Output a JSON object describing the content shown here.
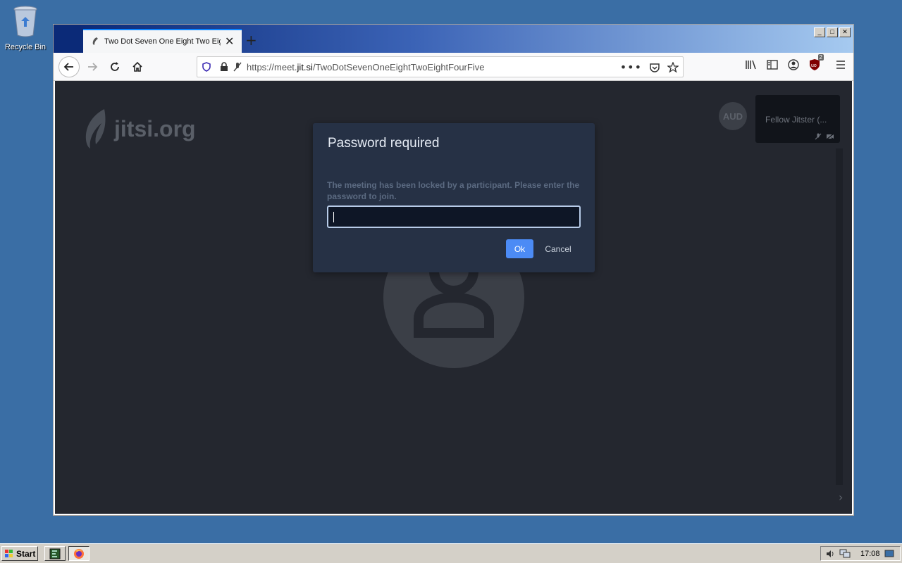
{
  "desktop": {
    "recycle_bin_label": "Recycle Bin"
  },
  "browser": {
    "tab_title": "Two Dot Seven One Eight Two Eight Four Five",
    "url_prefix": "https://meet.",
    "url_domain": "jit.si",
    "url_path": "/TwoDotSevenOneEightTwoEightFourFive",
    "ublock_badge": "2"
  },
  "page": {
    "logo_text": "jitsi.org",
    "aud_badge": "AUD",
    "participant_name": "Fellow Jitster (...",
    "colors": {
      "background": "#24272f",
      "dialog": "#263145",
      "primary": "#4c8bf5"
    }
  },
  "dialog": {
    "title": "Password required",
    "description": "The meeting has been locked by a participant. Please enter the password to join.",
    "password_value": "",
    "ok_label": "Ok",
    "cancel_label": "Cancel"
  },
  "taskbar": {
    "start_label": "Start",
    "clock": "17:08"
  }
}
